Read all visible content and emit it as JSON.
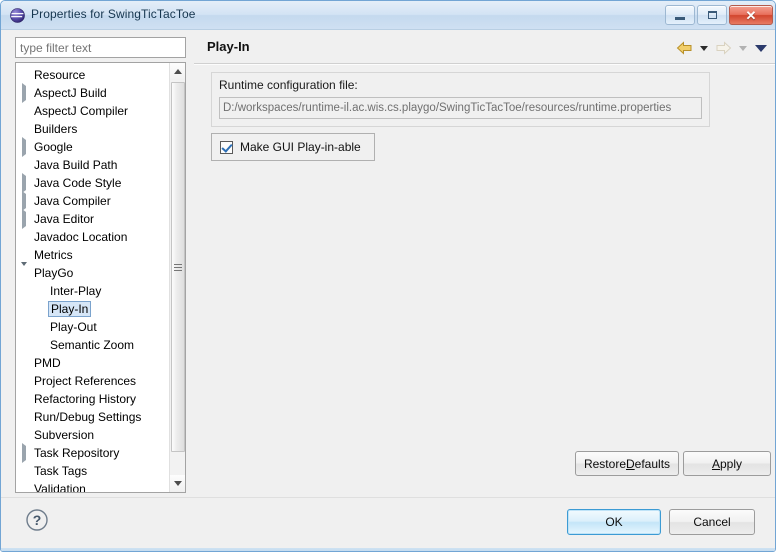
{
  "window": {
    "title": "Properties for SwingTicTacToe",
    "icon": "eclipse-globe-icon",
    "controls": {
      "minimize": "minimize-button",
      "maximize": "maximize-button",
      "close": "✕"
    }
  },
  "filter": {
    "value": "",
    "placeholder": "type filter text"
  },
  "tree": {
    "items": [
      {
        "label": "Resource",
        "indent": 1,
        "expander": "none",
        "selected": false
      },
      {
        "label": "AspectJ Build",
        "indent": 1,
        "expander": "closed",
        "selected": false
      },
      {
        "label": "AspectJ Compiler",
        "indent": 1,
        "expander": "none",
        "selected": false
      },
      {
        "label": "Builders",
        "indent": 1,
        "expander": "none",
        "selected": false
      },
      {
        "label": "Google",
        "indent": 1,
        "expander": "closed",
        "selected": false
      },
      {
        "label": "Java Build Path",
        "indent": 1,
        "expander": "none",
        "selected": false
      },
      {
        "label": "Java Code Style",
        "indent": 1,
        "expander": "closed",
        "selected": false
      },
      {
        "label": "Java Compiler",
        "indent": 1,
        "expander": "closed",
        "selected": false
      },
      {
        "label": "Java Editor",
        "indent": 1,
        "expander": "closed",
        "selected": false
      },
      {
        "label": "Javadoc Location",
        "indent": 1,
        "expander": "none",
        "selected": false
      },
      {
        "label": "Metrics",
        "indent": 1,
        "expander": "none",
        "selected": false
      },
      {
        "label": "PlayGo",
        "indent": 1,
        "expander": "open",
        "selected": false
      },
      {
        "label": "Inter-Play",
        "indent": 2,
        "expander": "none",
        "selected": false
      },
      {
        "label": "Play-In",
        "indent": 2,
        "expander": "none",
        "selected": true
      },
      {
        "label": "Play-Out",
        "indent": 2,
        "expander": "none",
        "selected": false
      },
      {
        "label": "Semantic Zoom",
        "indent": 2,
        "expander": "none",
        "selected": false
      },
      {
        "label": "PMD",
        "indent": 1,
        "expander": "none",
        "selected": false
      },
      {
        "label": "Project References",
        "indent": 1,
        "expander": "none",
        "selected": false
      },
      {
        "label": "Refactoring History",
        "indent": 1,
        "expander": "none",
        "selected": false
      },
      {
        "label": "Run/Debug Settings",
        "indent": 1,
        "expander": "none",
        "selected": false
      },
      {
        "label": "Subversion",
        "indent": 1,
        "expander": "none",
        "selected": false
      },
      {
        "label": "Task Repository",
        "indent": 1,
        "expander": "closed",
        "selected": false
      },
      {
        "label": "Task Tags",
        "indent": 1,
        "expander": "none",
        "selected": false
      },
      {
        "label": "Validation",
        "indent": 1,
        "expander": "none",
        "selected": false
      }
    ]
  },
  "page": {
    "title": "Play-In",
    "nav": {
      "back": "back-arrow-icon",
      "back_menu": "back-history-dropdown",
      "forward": "forward-arrow-icon",
      "forward_menu": "forward-history-dropdown",
      "menu": "view-menu-dropdown"
    },
    "group": {
      "label": "Runtime configuration file:",
      "path_value": "D:/workspaces/runtime-il.ac.wis.cs.playgo/SwingTicTacToe/resources/runtime.properties"
    },
    "checkbox": {
      "label": "Make GUI Play-in-able",
      "checked": true
    },
    "buttons": {
      "restore_defaults_pre": "Restore ",
      "restore_defaults_mnemonic": "D",
      "restore_defaults_post": "efaults",
      "apply_mnemonic": "A",
      "apply_post": "pply"
    }
  },
  "footer": {
    "help": "help-button",
    "ok": "OK",
    "cancel": "Cancel"
  },
  "colors": {
    "titlebar_text": "#16364f",
    "selection_fill": "#d6e6f7",
    "selection_border": "#7ba3cd",
    "default_button_border": "#3c9bd4",
    "close_button": "#d2452e",
    "back_arrow": "#e0a92a"
  }
}
